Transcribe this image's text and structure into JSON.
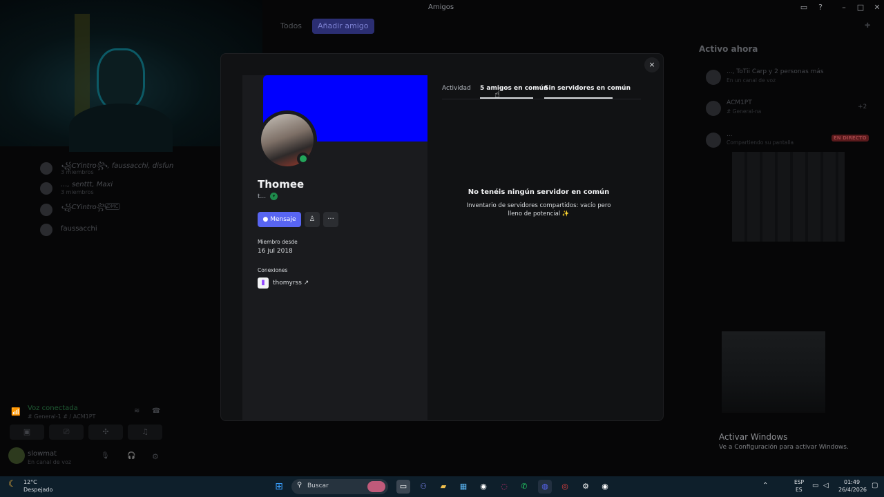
{
  "window": {
    "title": "Amigos"
  },
  "header": {
    "tabs": [
      "Todos"
    ],
    "add_friend": "Añadir amigo"
  },
  "sidebar": {
    "items": [
      {
        "name": "꧁CYintro꧂, faussacchi, disfun",
        "sub": "3 miembros"
      },
      {
        "name": "..., senttt, Maxi",
        "sub": "3 miembros"
      },
      {
        "name": "꧁CYintro꧂",
        "tag": "DMC"
      },
      {
        "name": "faussacchi"
      }
    ]
  },
  "voice": {
    "status": "Voz conectada",
    "channel": "# General-1 # / ACM1PT"
  },
  "user": {
    "name": "slowmat",
    "status": "En canal de voz"
  },
  "profile": {
    "display_name": "Thomee",
    "username": "t...",
    "message_button": "Mensaje",
    "member_since_label": "Miembro desde",
    "member_since": "16 jul 2018",
    "connections_label": "Conexiones",
    "connection": {
      "name": "thomyrss",
      "arrow": "↗"
    },
    "tabs": [
      "Actividad",
      "5 amigos en común",
      "Sin servidores en común"
    ],
    "empty_title": "No tenéis ningún servidor en común",
    "empty_desc": "Inventario de servidores compartidos: vacío pero lleno de potencial ✨",
    "close": "×"
  },
  "activity": {
    "title": "Activo ahora",
    "items": [
      {
        "name": "..., ToTii Carp y 2 personas más",
        "sub": "En un canal de voz"
      },
      {
        "name": "ACM1PT",
        "sub": "# General-na",
        "count": "+2"
      },
      {
        "name": "...",
        "sub": "Compartiendo su pantalla",
        "badge": "EN DIRECTO"
      }
    ]
  },
  "activate_windows": {
    "title": "Activar Windows",
    "desc": "Ve a Configuración para activar Windows."
  },
  "taskbar": {
    "temp": "12°C",
    "weather": "Despejado",
    "search": "Buscar",
    "lang1": "ESP",
    "lang2": "ES",
    "time": "01:49",
    "date": "26/4/2026"
  }
}
